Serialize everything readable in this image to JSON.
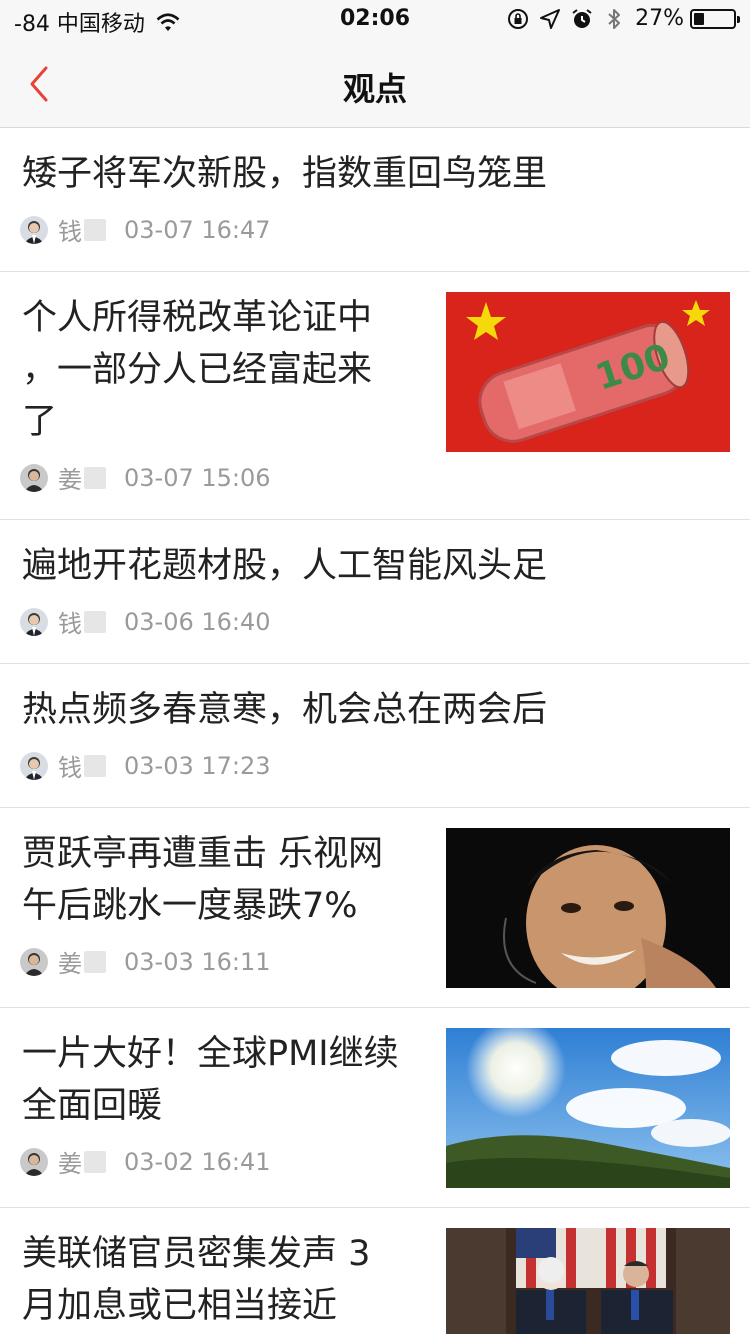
{
  "status_bar": {
    "carrier": "-84 中国移动",
    "time": "02:06",
    "battery": "27%",
    "battery_level": 0.27
  },
  "nav": {
    "title": "观点"
  },
  "articles": [
    {
      "title": "矮子将军次新股，指数重回鸟笼里",
      "author": "钱",
      "time": "03-07 16:47",
      "thumbnail": "none"
    },
    {
      "title_lines": [
        "个人所得税改革论证中",
        "，一部分人已经富起来",
        "了"
      ],
      "author": "姜",
      "time": "03-07 15:06",
      "thumbnail": "banknote-flag-image"
    },
    {
      "title": "遍地开花题材股，人工智能风头足",
      "author": "钱",
      "time": "03-06 16:40",
      "thumbnail": "none"
    },
    {
      "title": "热点频多春意寒，机会总在两会后",
      "author": "钱",
      "time": "03-03 17:23",
      "thumbnail": "none"
    },
    {
      "title_lines": [
        "贾跃亭再遭重击 乐视网",
        "午后跳水一度暴跌7%"
      ],
      "author": "姜",
      "time": "03-03 16:11",
      "thumbnail": "portrait-image"
    },
    {
      "title_lines": [
        "一片大好！全球PMI继续",
        "全面回暖"
      ],
      "author": "姜",
      "time": "03-02 16:41",
      "thumbnail": "sky-landscape-image"
    },
    {
      "title_lines": [
        "美联储官员密集发声 3",
        "月加息或已相当接近"
      ],
      "author": "",
      "time": "",
      "thumbnail": "officials-image"
    }
  ],
  "colors": {
    "accent_back": "#e8413a",
    "meta_text": "#9a9a9a"
  }
}
